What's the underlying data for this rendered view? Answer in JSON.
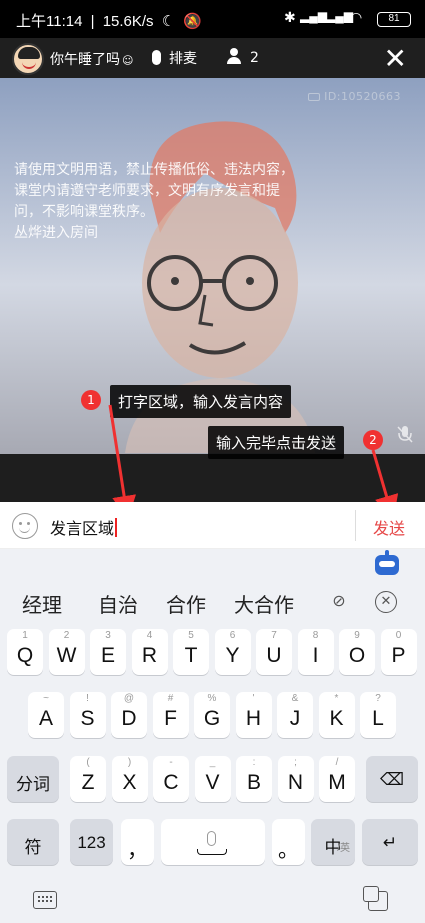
{
  "status": {
    "time": "上午11:14",
    "speed": "15.6K/s",
    "battery": "81"
  },
  "topbar": {
    "username": "你午睡了吗",
    "username_symbol": "☺",
    "queue_label": "排麦",
    "people_count": "2"
  },
  "video": {
    "id": "ID:10520663",
    "notice": [
      "请使用文明用语，禁止传播低俗、违法内容，",
      "课堂内请遵守老师要求，文明有序发言和提",
      "问，不影响课堂秩序。",
      "丛烨进入房间"
    ]
  },
  "annotations": [
    {
      "badge": "1",
      "text": "打字区域，输入发言内容"
    },
    {
      "badge": "2",
      "text": "输入完毕点击发送"
    }
  ],
  "input": {
    "value": "发言区域",
    "send_label": "发送"
  },
  "candidates": [
    "经理",
    "自治",
    "合作",
    "大合作"
  ],
  "keyboard": {
    "row1": [
      [
        "1",
        "Q"
      ],
      [
        "2",
        "W"
      ],
      [
        "3",
        "E"
      ],
      [
        "4",
        "R"
      ],
      [
        "5",
        "T"
      ],
      [
        "6",
        "Y"
      ],
      [
        "7",
        "U"
      ],
      [
        "8",
        "I"
      ],
      [
        "9",
        "O"
      ],
      [
        "0",
        "P"
      ]
    ],
    "row2": [
      [
        "~",
        "A"
      ],
      [
        "!",
        "S"
      ],
      [
        "@",
        "D"
      ],
      [
        "#",
        "F"
      ],
      [
        "%",
        "G"
      ],
      [
        "'",
        "H"
      ],
      [
        "&",
        "J"
      ],
      [
        "*",
        "K"
      ],
      [
        "?",
        "L"
      ]
    ],
    "row3": [
      [
        "(",
        "Z"
      ],
      [
        ")",
        "X"
      ],
      [
        "-",
        "C"
      ],
      [
        "_",
        "V"
      ],
      [
        ":",
        "B"
      ],
      [
        ";",
        "N"
      ],
      [
        "/",
        "M"
      ]
    ],
    "shift_label": "分词",
    "symbol_label": "符",
    "num_label": "123",
    "comma": "，",
    "period": "。",
    "lang_label": "中",
    "lang_sub": "/英",
    "enter_label": "↵",
    "backspace_label": "⌫"
  },
  "colors": {
    "accent_red": "#f03131",
    "send_red": "#e64848"
  }
}
